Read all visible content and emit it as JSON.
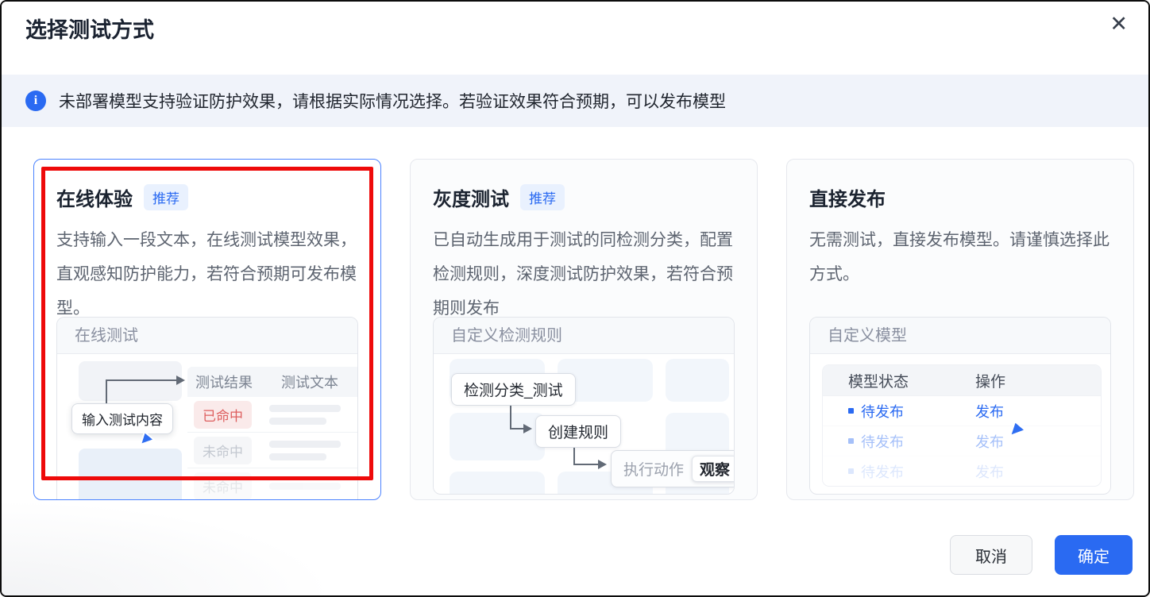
{
  "dialog": {
    "title": "选择测试方式",
    "close_icon": "✕"
  },
  "banner": {
    "text": "未部署模型支持验证防护效果，请根据实际情况选择。若验证效果符合预期，可以发布模型"
  },
  "cards": [
    {
      "title": "在线体验",
      "badge": "推荐",
      "description": "支持输入一段文本，在线测试模型效果，直观感知防护能力，若符合预期可发布模型。",
      "preview": {
        "title": "在线测试",
        "tooltip": "输入测试内容",
        "columns": [
          "测试结果",
          "测试文本"
        ],
        "rows": [
          {
            "status": "已命中"
          },
          {
            "status": "未命中"
          },
          {
            "status": "未命中"
          }
        ]
      }
    },
    {
      "title": "灰度测试",
      "badge": "推荐",
      "description": "已自动生成用于测试的同检测分类，配置检测规则，深度测试防护效果，若符合预期则发布",
      "preview": {
        "title": "自定义检测规则",
        "flow": {
          "step1": "检测分类_测试",
          "step2": "创建规则",
          "step3_label": "执行动作",
          "step3_value": "观察"
        }
      }
    },
    {
      "title": "直接发布",
      "description": "无需测试，直接发布模型。请谨慎选择此方式。",
      "preview": {
        "title": "自定义模型",
        "columns": [
          "模型状态",
          "操作"
        ],
        "rows": [
          {
            "status": "待发布",
            "action": "发布"
          },
          {
            "status": "待发布",
            "action": "发布"
          },
          {
            "status": "待发布",
            "action": "发布"
          }
        ]
      }
    }
  ],
  "footer": {
    "cancel": "取消",
    "confirm": "确定"
  },
  "colors": {
    "primary": "#2a6af2",
    "badge_bg": "#e9f1fe",
    "banner_bg": "#f0f3fa",
    "highlight_red": "#ee0a0a",
    "hit_red": "#dd5e5e",
    "selected_border": "#4a82ff"
  }
}
